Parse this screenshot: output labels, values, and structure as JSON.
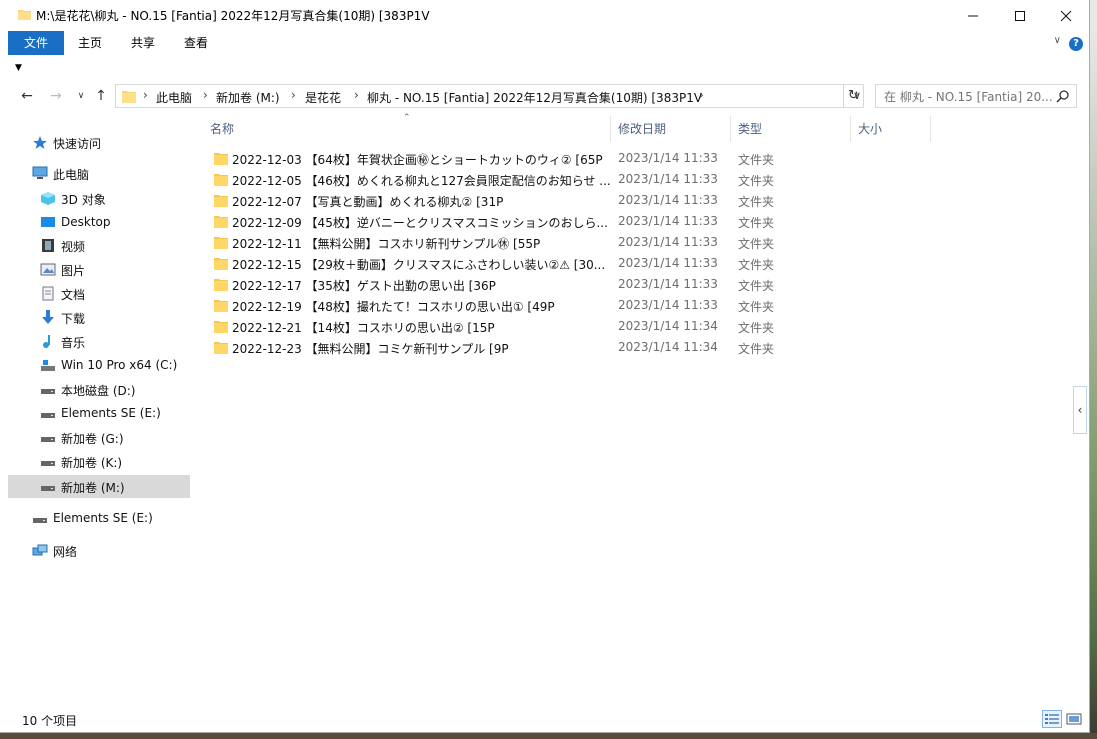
{
  "window": {
    "title": "M:\\是花花\\柳丸 - NO.15 [Fantia] 2022年12月写真合集(10期) [383P1V",
    "minimize_icon": "minimize-icon",
    "maximize_icon": "maximize-icon",
    "close_icon": "close-icon"
  },
  "ribbon": {
    "tabs": [
      {
        "label": "文件"
      },
      {
        "label": "主页"
      },
      {
        "label": "共享"
      },
      {
        "label": "查看"
      }
    ]
  },
  "navigation": {
    "back_icon": "arrow-left-icon",
    "forward_icon": "arrow-right-icon",
    "recent_icon": "chevron-down-icon",
    "up_icon": "arrow-up-icon",
    "breadcrumbs": [
      {
        "label": "此电脑"
      },
      {
        "label": "新加卷 (M:)"
      },
      {
        "label": "是花花"
      },
      {
        "label": "柳丸 - NO.15 [Fantia] 2022年12月写真合集(10期) [383P1V"
      }
    ],
    "search_placeholder": "在 柳丸 - NO.15 [Fantia] 20...",
    "refresh_icon": "refresh-icon"
  },
  "sidebar": {
    "items": [
      {
        "label": "快速访问",
        "icon": "star-icon"
      },
      {
        "label": "此电脑",
        "icon": "computer-icon"
      },
      {
        "label": "3D 对象",
        "icon": "cube-icon"
      },
      {
        "label": "Desktop",
        "icon": "desktop-icon"
      },
      {
        "label": "视频",
        "icon": "video-icon"
      },
      {
        "label": "图片",
        "icon": "picture-icon"
      },
      {
        "label": "文档",
        "icon": "document-icon"
      },
      {
        "label": "下载",
        "icon": "download-icon"
      },
      {
        "label": "音乐",
        "icon": "music-icon"
      },
      {
        "label": "Win 10 Pro x64 (C:)",
        "icon": "system-drive-icon"
      },
      {
        "label": "本地磁盘 (D:)",
        "icon": "drive-icon"
      },
      {
        "label": "Elements SE (E:)",
        "icon": "drive-icon"
      },
      {
        "label": "新加卷 (G:)",
        "icon": "drive-icon"
      },
      {
        "label": "新加卷 (K:)",
        "icon": "drive-icon"
      },
      {
        "label": "新加卷 (M:)",
        "icon": "drive-icon"
      },
      {
        "label": "Elements SE (E:)",
        "icon": "drive-icon"
      },
      {
        "label": "网络",
        "icon": "network-icon"
      }
    ]
  },
  "file_list": {
    "columns": [
      {
        "label": "名称"
      },
      {
        "label": "修改日期"
      },
      {
        "label": "类型"
      },
      {
        "label": "大小"
      }
    ],
    "rows": [
      {
        "name": "2022-12-03 【64枚】年賀状企画㊙とショートカットのウィ② [65P",
        "date": "2023/1/14 11:33",
        "type": "文件夹"
      },
      {
        "name": "2022-12-05 【46枚】めくれる柳丸と127会員限定配信のお知らせ ...",
        "date": "2023/1/14 11:33",
        "type": "文件夹"
      },
      {
        "name": "2022-12-07 【写真と動画】めくれる柳丸② [31P",
        "date": "2023/1/14 11:33",
        "type": "文件夹"
      },
      {
        "name": "2022-12-09 【45枚】逆バニーとクリスマスコミッションのおしら...",
        "date": "2023/1/14 11:33",
        "type": "文件夹"
      },
      {
        "name": "2022-12-11 【無料公開】コスホリ新刊サンプル㊡ [55P",
        "date": "2023/1/14 11:33",
        "type": "文件夹"
      },
      {
        "name": "2022-12-15 【29枚＋動画】クリスマスにふさわしい装い②⚠ [30...",
        "date": "2023/1/14 11:33",
        "type": "文件夹"
      },
      {
        "name": "2022-12-17 【35枚】ゲスト出勤の思い出 [36P",
        "date": "2023/1/14 11:33",
        "type": "文件夹"
      },
      {
        "name": "2022-12-19 【48枚】撮れたて！コスホリの思い出① [49P",
        "date": "2023/1/14 11:33",
        "type": "文件夹"
      },
      {
        "name": "2022-12-21 【14枚】コスホリの思い出② [15P",
        "date": "2023/1/14 11:34",
        "type": "文件夹"
      },
      {
        "name": "2022-12-23 【無料公開】コミケ新刊サンプル [9P",
        "date": "2023/1/14 11:34",
        "type": "文件夹"
      }
    ]
  },
  "status": {
    "item_count": "10 个项目",
    "details_view_icon": "details-view-icon",
    "large_icons_view_icon": "large-icons-view-icon"
  },
  "colors": {
    "accent": "#1a6fc4",
    "folder": "#ffd766",
    "selected": "#d9d9d9"
  }
}
